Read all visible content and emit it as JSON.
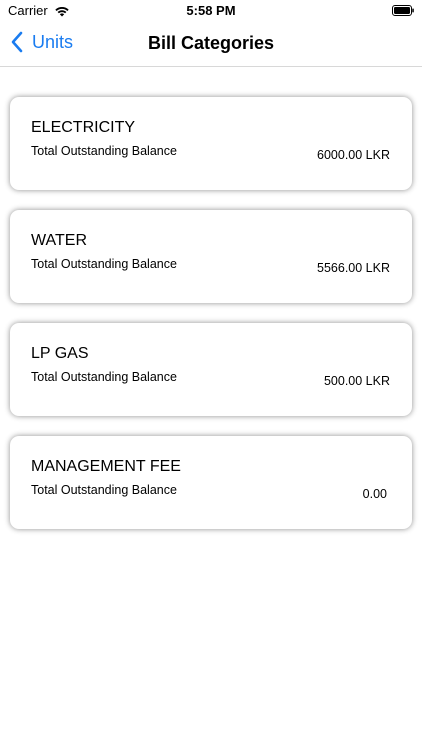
{
  "status_bar": {
    "carrier": "Carrier",
    "time": "5:58 PM"
  },
  "nav": {
    "back_label": "Units",
    "title": "Bill Categories"
  },
  "categories": [
    {
      "title": "ELECTRICITY",
      "label": "Total Outstanding Balance",
      "amount": "6000.00 LKR"
    },
    {
      "title": "WATER",
      "label": "Total Outstanding Balance",
      "amount": "5566.00 LKR"
    },
    {
      "title": "LP GAS",
      "label": "Total Outstanding Balance",
      "amount": "500.00 LKR"
    },
    {
      "title": "MANAGEMENT FEE",
      "label": "Total Outstanding Balance",
      "amount": "0.00"
    }
  ],
  "colors": {
    "accent": "#1a7cf0"
  }
}
